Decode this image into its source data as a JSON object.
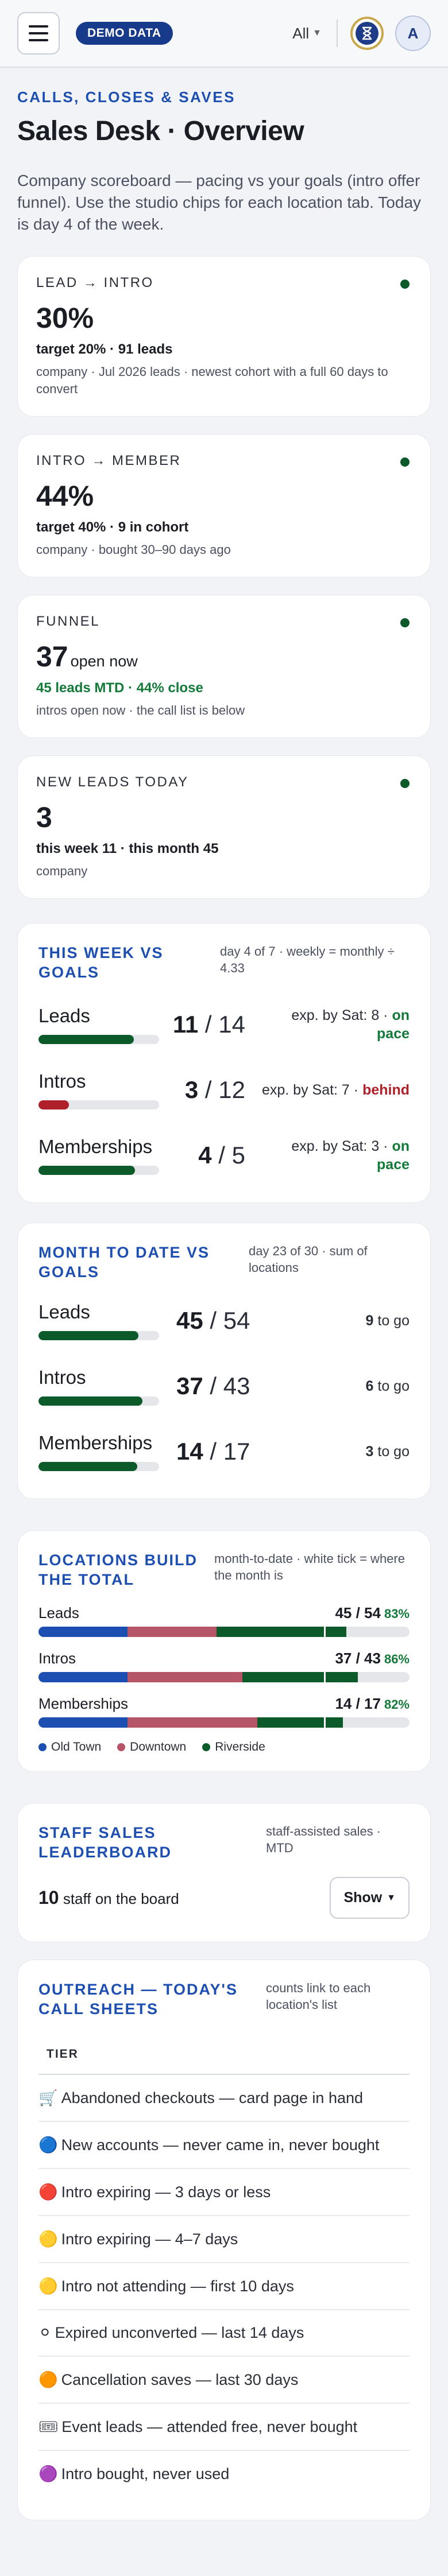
{
  "topbar": {
    "demo_badge": "DEMO DATA",
    "filter_label": "All",
    "avatar_initial": "A"
  },
  "header": {
    "eyebrow": "CALLS, CLOSES & SAVES",
    "title": "Sales Desk · Overview",
    "intro": "Company scoreboard — pacing vs your goals (intro offer funnel). Use the studio chips for each location tab. Today is day 4 of the week."
  },
  "kpis": [
    {
      "label": "LEAD → INTRO",
      "value": "30%",
      "value_suffix": "",
      "sub": "target 20% · 91 leads",
      "sub_style": "plain",
      "note": "company · Jul 2026 leads · newest cohort with a full 60 days to convert"
    },
    {
      "label": "INTRO → MEMBER",
      "value": "44%",
      "value_suffix": "",
      "sub": "target 40% · 9 in cohort",
      "sub_style": "plain",
      "note": "company · bought 30–90 days ago"
    },
    {
      "label": "FUNNEL",
      "value": "37",
      "value_suffix": "open now",
      "sub": "45 leads MTD · 44% close",
      "sub_style": "green",
      "note": "intros open now · the call list is below"
    },
    {
      "label": "NEW LEADS TODAY",
      "value": "3",
      "value_suffix": "",
      "sub": "this week 11 · this month 45",
      "sub_style": "plain",
      "note": "company"
    }
  ],
  "week": {
    "title": "THIS WEEK VS GOALS",
    "note": "day 4 of 7 · weekly = monthly ÷ 4.33",
    "rows": [
      {
        "name": "Leads",
        "actual": "11",
        "goal": "14",
        "fill": 0.79,
        "color": "#0c5a2a",
        "exp_prefix": "exp. by Sat: 8 · ",
        "status": "on pace",
        "status_class": "on-pace"
      },
      {
        "name": "Intros",
        "actual": "3",
        "goal": "12",
        "fill": 0.25,
        "color": "#b0202a",
        "exp_prefix": "exp. by Sat: 7 · ",
        "status": "behind",
        "status_class": "behind"
      },
      {
        "name": "Memberships",
        "actual": "4",
        "goal": "5",
        "fill": 0.8,
        "color": "#0c5a2a",
        "exp_prefix": "exp. by Sat: 3 · ",
        "status": "on pace",
        "status_class": "on-pace"
      }
    ]
  },
  "month": {
    "title": "MONTH TO DATE VS GOALS",
    "note": "day 23 of 30 · sum of locations",
    "rows": [
      {
        "name": "Leads",
        "actual": "45",
        "goal": "54",
        "fill": 0.83,
        "to_go": "9",
        "to_go_label": "to go"
      },
      {
        "name": "Intros",
        "actual": "37",
        "goal": "43",
        "fill": 0.86,
        "to_go": "6",
        "to_go_label": "to go"
      },
      {
        "name": "Memberships",
        "actual": "14",
        "goal": "17",
        "fill": 0.82,
        "to_go": "3",
        "to_go_label": "to go"
      }
    ]
  },
  "locations": {
    "title": "LOCATIONS BUILD THE TOTAL",
    "note": "month-to-date · white tick = where the month is",
    "month_progress": 0.77,
    "colors": {
      "Old Town": "#1d4fb2",
      "Downtown": "#b65468",
      "Riverside": "#0c5a2a"
    },
    "rows": [
      {
        "name": "Leads",
        "value": "45 / 54",
        "pct": "83%",
        "segments": [
          0.24,
          0.24,
          0.35
        ]
      },
      {
        "name": "Intros",
        "value": "37 / 43",
        "pct": "86%",
        "segments": [
          0.24,
          0.31,
          0.31
        ]
      },
      {
        "name": "Memberships",
        "value": "14 / 17",
        "pct": "82%",
        "segments": [
          0.24,
          0.35,
          0.23
        ]
      }
    ],
    "legend": [
      "Old Town",
      "Downtown",
      "Riverside"
    ]
  },
  "leaderboard": {
    "title": "STAFF SALES LEADERBOARD",
    "note": "staff-assisted sales · MTD",
    "count": "10",
    "count_label": "staff on the board",
    "show_label": "Show"
  },
  "outreach": {
    "title": "OUTREACH — TODAY'S CALL SHEETS",
    "note": "counts link to each location's list",
    "column": "TIER",
    "tiers": [
      {
        "icon": "🛒",
        "label": "Abandoned checkouts — card page in hand"
      },
      {
        "icon": "🔵",
        "label": "New accounts — never came in, never bought"
      },
      {
        "icon": "🔴",
        "label": "Intro expiring — 3 days or less"
      },
      {
        "icon": "🟡",
        "label": "Intro expiring — 4–7 days"
      },
      {
        "icon": "🟡",
        "label": "Intro not attending — first 10 days"
      },
      {
        "icon": "⚪",
        "label": "Expired unconverted — last 14 days"
      },
      {
        "icon": "🟠",
        "label": "Cancellation saves — last 30 days"
      },
      {
        "icon": "🎟",
        "label": "Event leads — attended free, never bought"
      },
      {
        "icon": "🟣",
        "label": "Intro bought, never used"
      }
    ]
  }
}
